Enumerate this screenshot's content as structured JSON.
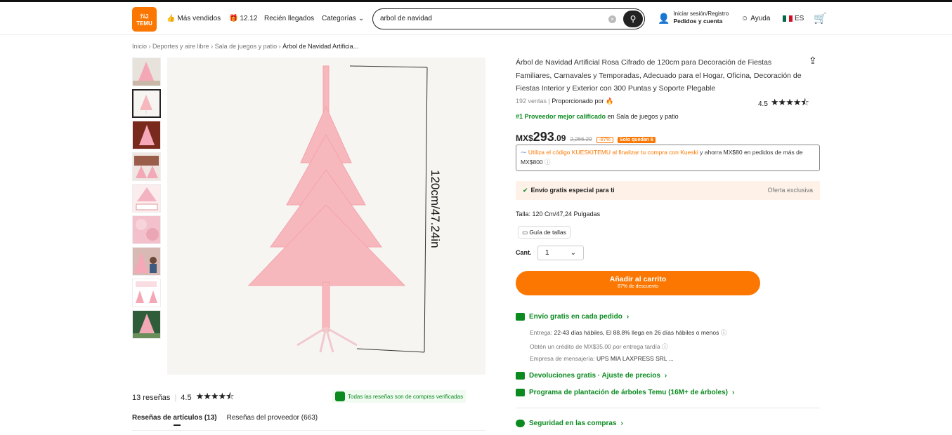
{
  "header": {
    "logo_top": "ﾃﾑｽ",
    "logo_text": "TEMU",
    "nav": [
      {
        "label": "Más vendidos",
        "icon": "thumbs-up-icon"
      },
      {
        "label": "12.12",
        "icon": "gift-icon"
      },
      {
        "label": "Recién llegados",
        "icon": ""
      },
      {
        "label": "Categorías",
        "icon": "chevron-down-icon"
      }
    ],
    "search_value": "arbol de navidad",
    "login_line1": "Iniciar sesión/Registro",
    "login_line2": "Pedidos y cuenta",
    "help": "Ayuda",
    "lang": "ES"
  },
  "breadcrumb": [
    "Inicio",
    "Deportes y aire libre",
    "Sala de juegos y patio",
    "Árbol de Navidad Artificia..."
  ],
  "image": {
    "dimension_label": "120cm/47.24in"
  },
  "product": {
    "title": "Árbol de Navidad Artificial Rosa Cifrado de 120cm para Decoración de Fiestas Familiares, Carnavales y Temporadas, Adecuado para el Hogar, Oficina, Decoración de Fiestas Interior y Exterior con 300 Puntas y Soporte Plegable",
    "sales": "192 ventas",
    "provided_by": "Proporcionado por",
    "rating": "4.5",
    "best_seller": "#1 Proveedor mejor calificado",
    "best_seller_in": "en Sala de juegos y patio",
    "price_currency": "MX$",
    "price_int": "293",
    "price_dec": ".09",
    "price_old": "2,266.29",
    "discount": "-87%",
    "stock": "Solo quedan 6",
    "kueski_orange": "Utiliza el código KUESKITEMU al finalizar tu compra con Kueski",
    "kueski_rest": "y ahorra MX$80 en pedidos de más de MX$800",
    "free_ship": "Envío gratis especial para ti",
    "exclusive": "Oferta exclusiva",
    "size": "Talla: 120 Cm/47,24 Pulgadas",
    "size_guide": "Guía de tallas",
    "qty_label": "Cant.",
    "qty_value": "1",
    "cart_label": "Añadir al carrito",
    "cart_sub": "87% de descuento"
  },
  "shipping": {
    "title": "Envío gratis en cada pedido",
    "delivery_prefix": "Entrega:",
    "delivery": "22-43 días hábiles, El 88.8% llega en 26 días hábiles o menos",
    "credit": "Obtén un crédito de MX$35.00 por entrega tardía",
    "carrier_label": "Empresa de mensajería:",
    "carriers": "UPS  MIA LAXPRESS SRL ...",
    "returns": "Devoluciones gratis · Ajuste de precios",
    "planting": "Programa de plantación de árboles Temu (16M+ de árboles)",
    "security": "Seguridad en las compras"
  },
  "reviews": {
    "count": "13 reseñas",
    "rating": "4.5",
    "verified": "Todas las reseñas son de compras verificadas",
    "tab1": "Reseñas de artículos (13)",
    "tab2": "Reseñas del proveedor (663)"
  },
  "colors": {
    "accent": "#fb7701",
    "green": "#0a8a1f",
    "tree_pink": "#f7b8bd"
  }
}
